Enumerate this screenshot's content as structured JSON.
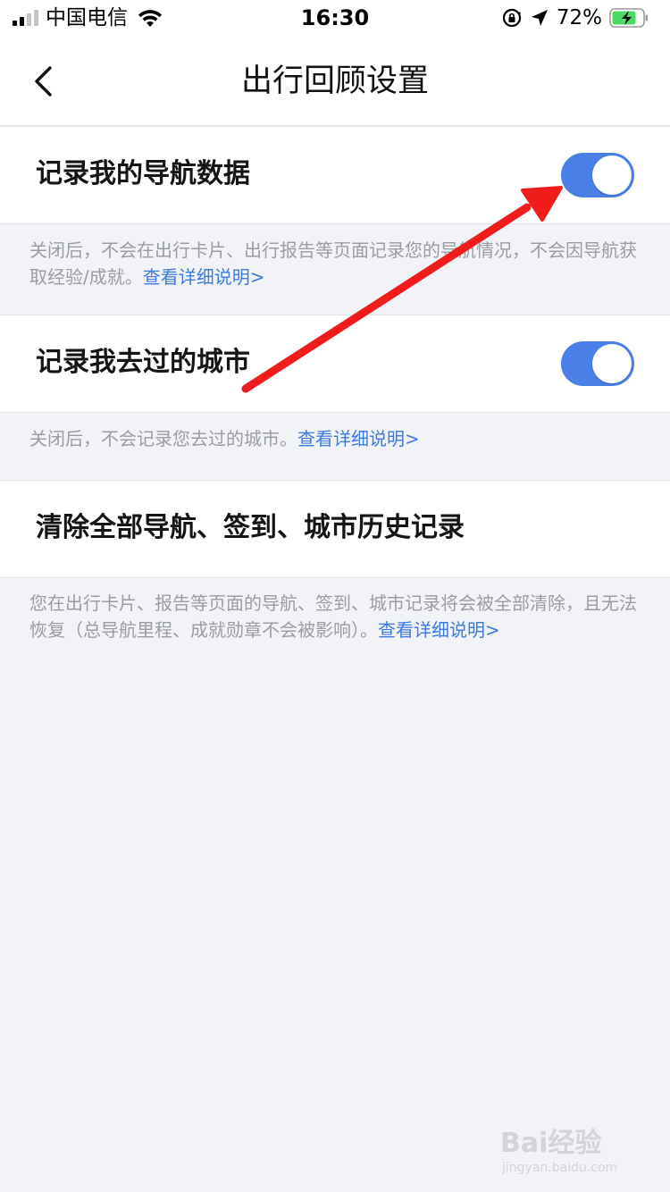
{
  "status_bar": {
    "carrier": "中国电信",
    "time": "16:30",
    "battery_percent": "72%"
  },
  "nav": {
    "title": "出行回顾设置"
  },
  "settings": [
    {
      "label": "记录我的导航数据",
      "toggle_on": true,
      "description": "关闭后，不会在出行卡片、出行报告等页面记录您的导航情况，不会因导航获取经验/成就。",
      "link": "查看详细说明>"
    },
    {
      "label": "记录我去过的城市",
      "toggle_on": true,
      "description": "关闭后，不会记录您去过的城市。",
      "link": "查看详细说明>"
    },
    {
      "label": "清除全部导航、签到、城市历史记录",
      "description": "您在出行卡片、报告等页面的导航、签到、城市记录将会被全部清除，且无法恢复（总导航里程、成就勋章不会被影响）。",
      "link": "查看详细说明>"
    }
  ],
  "watermark": {
    "logo": "Bai经验",
    "url": "jingyan.baidu.com"
  },
  "colors": {
    "accent": "#4a7fe7",
    "link": "#3d7ae0",
    "background": "#f2f3f7",
    "annotation_arrow": "#f01c1c"
  },
  "icons": [
    "back-chevron-icon",
    "wifi-icon",
    "signal-icon",
    "orientation-lock-icon",
    "location-arrow-icon",
    "battery-charging-icon"
  ]
}
